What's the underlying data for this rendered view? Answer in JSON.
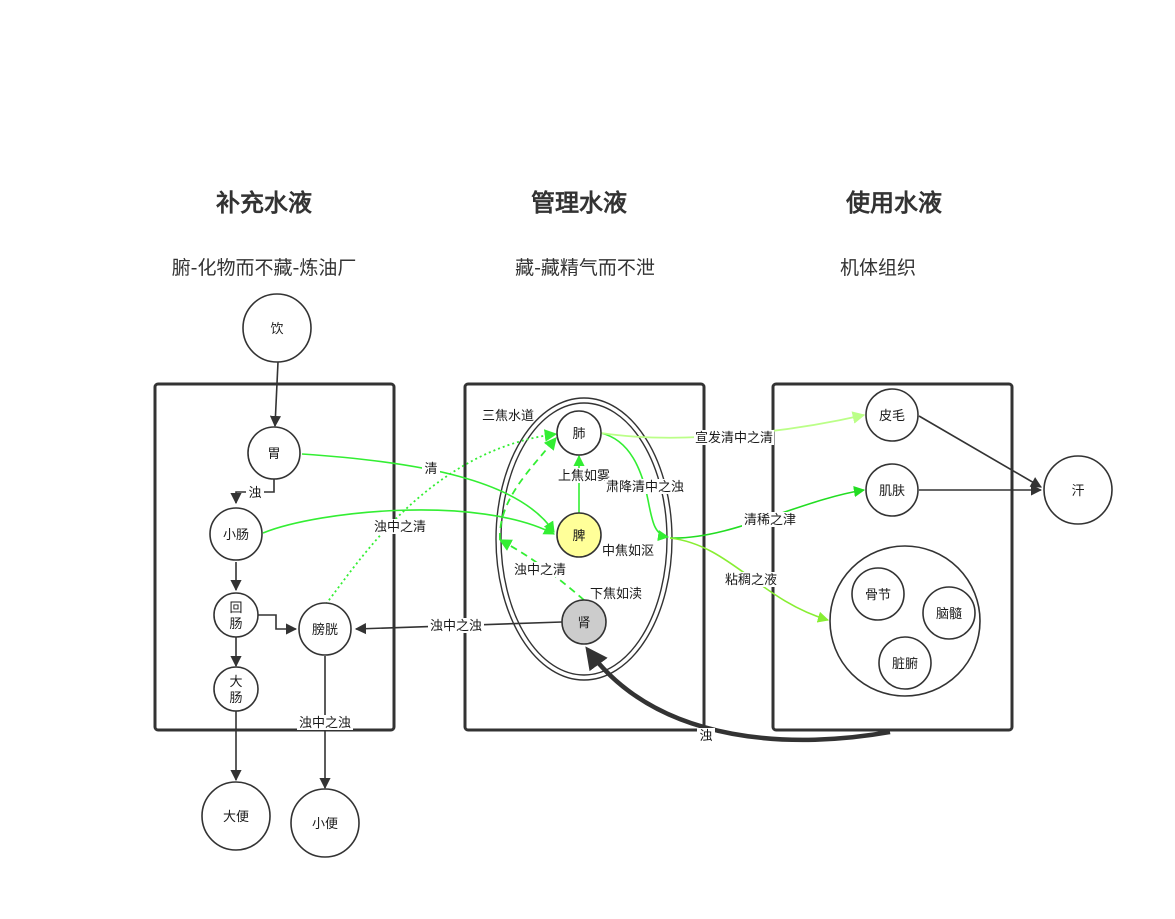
{
  "colors": {
    "dark": "#333333",
    "green": "#33ee33",
    "bright_green": "#22dd22",
    "light_green": "#bbff88",
    "lime": "#88ee33",
    "spleen_fill": "#ffff99",
    "kidney_fill": "#cccccc"
  },
  "columns": {
    "replenish": {
      "title": "补充水液",
      "subtitle": "腑-化物而不藏-炼油厂"
    },
    "manage": {
      "title": "管理水液",
      "subtitle": "藏-藏精气而不泄"
    },
    "use": {
      "title": "使用水液",
      "subtitle": "机体组织"
    }
  },
  "nodes": {
    "drink": "饮",
    "stomach": "胃",
    "small_intestine": "小肠",
    "ileum": [
      "回",
      "肠"
    ],
    "large_intestine": [
      "大",
      "肠"
    ],
    "bladder": "膀胱",
    "stool": "大便",
    "urine": "小便",
    "lung": "肺",
    "spleen": "脾",
    "kidney": "肾",
    "skin_hair": "皮毛",
    "muscle_skin": "肌肤",
    "sweat": "汗",
    "joints": "骨节",
    "brain_marrow": "脑髓",
    "organs": "脏腑"
  },
  "labels": {
    "san_jiao": "三焦水道",
    "upper_jiao": "上焦如雾",
    "middle_jiao": "中焦如沤",
    "lower_jiao": "下焦如渎",
    "turbid": "浊",
    "clear": "清",
    "clear_in_turbid_left": "浊中之清",
    "clear_in_turbid_inner": "浊中之清",
    "turbid_in_turbid_mid": "浊中之浊",
    "turbid_in_turbid_down": "浊中之浊",
    "descend": "肃降清中之浊",
    "disperse": "宣发清中之清",
    "thin_fluid": "清稀之津",
    "thick_fluid": "粘稠之液",
    "return_turbid": "浊"
  }
}
